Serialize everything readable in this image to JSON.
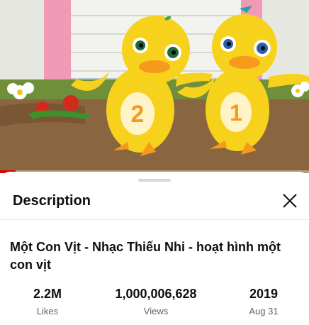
{
  "video": {
    "thumbnail_icon": "duck-cartoon",
    "duck_numbers": [
      "2",
      "1"
    ],
    "progress_fraction": 0.05
  },
  "description_panel": {
    "title": "Description",
    "close_icon": "close-icon",
    "video_title": "Một Con Vịt - Nhạc Thiếu Nhi - hoạt hình một con vịt",
    "stats": {
      "likes_value": "2.2M",
      "likes_label": "Likes",
      "views_value": "1,000,006,628",
      "views_label": "Views",
      "year_value": "2019",
      "date_label": "Aug 31"
    }
  },
  "colors": {
    "progress": "#e00000",
    "duck_body": "#f7d21c",
    "duck_beak": "#f59a1c"
  }
}
